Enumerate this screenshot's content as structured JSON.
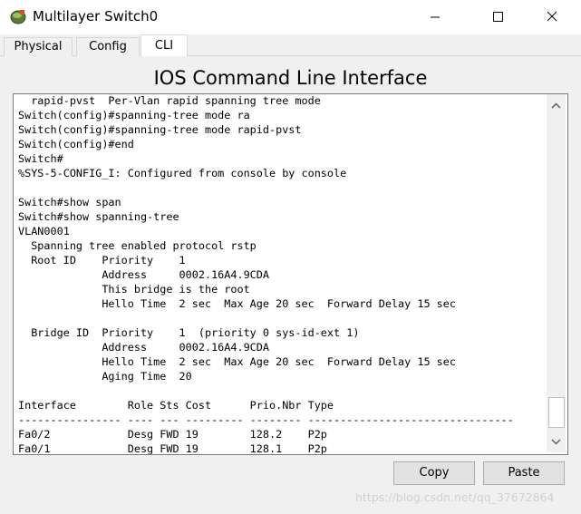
{
  "window": {
    "title": "Multilayer Switch0",
    "icon": "router-device-icon",
    "controls": {
      "minimize": "minimize-icon",
      "maximize": "maximize-icon",
      "close": "close-icon"
    }
  },
  "tabs": [
    {
      "label": "Physical",
      "active": false
    },
    {
      "label": "Config",
      "active": false
    },
    {
      "label": "CLI",
      "active": true
    }
  ],
  "cli": {
    "heading": "IOS Command Line Interface",
    "lines": [
      "  rapid-pvst  Per-Vlan rapid spanning tree mode",
      "Switch(config)#spanning-tree mode ra",
      "Switch(config)#spanning-tree mode rapid-pvst",
      "Switch(config)#end",
      "Switch#",
      "%SYS-5-CONFIG_I: Configured from console by console",
      "",
      "Switch#show span",
      "Switch#show spanning-tree",
      "VLAN0001",
      "  Spanning tree enabled protocol rstp",
      "  Root ID    Priority    1",
      "             Address     0002.16A4.9CDA",
      "             This bridge is the root",
      "             Hello Time  2 sec  Max Age 20 sec  Forward Delay 15 sec",
      "",
      "  Bridge ID  Priority    1  (priority 0 sys-id-ext 1)",
      "             Address     0002.16A4.9CDA",
      "             Hello Time  2 sec  Max Age 20 sec  Forward Delay 15 sec",
      "             Aging Time  20",
      "",
      "Interface        Role Sts Cost      Prio.Nbr Type",
      "---------------- ---- --- --------- -------- --------------------------------",
      "Fa0/2            Desg FWD 19        128.2    P2p",
      "Fa0/1            Desg FWD 19        128.1    P2p"
    ],
    "scrollbar": {
      "up_icon": "scroll-up-arrow-icon",
      "down_icon": "scroll-down-arrow-icon"
    }
  },
  "buttons": {
    "copy": "Copy",
    "paste": "Paste"
  },
  "watermark": "https://blog.csdn.net/qq_37672864"
}
